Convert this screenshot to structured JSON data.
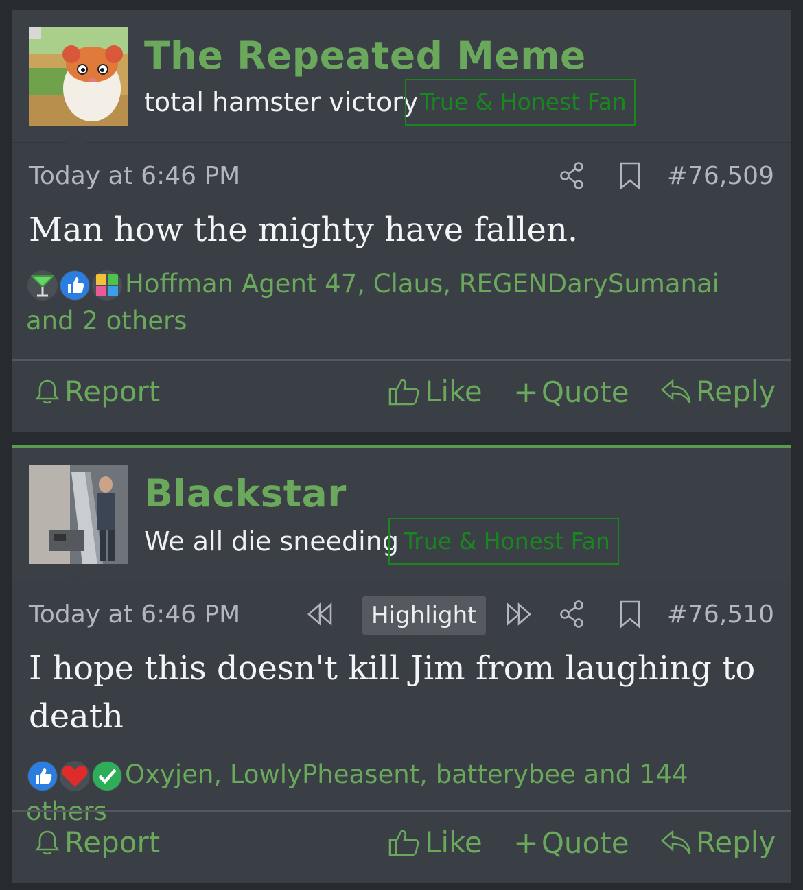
{
  "posts": [
    {
      "username": "The Repeated Meme",
      "user_title": "total hamster victory",
      "badge": "True & Honest Fan",
      "timestamp": "Today at 6:46 PM",
      "post_number": "#76,509",
      "message_lines": [
        "Man how the mighty have fallen."
      ],
      "reactions_text": "Hoffman Agent 47, Claus, REGENDarySumanai and 2 others",
      "reaction_icons": [
        "cocktail-icon",
        "thumbs-up-icon",
        "puzzle-icon"
      ],
      "actions": {
        "report": "Report",
        "like": "Like",
        "quote": "Quote",
        "reply": "Reply"
      }
    },
    {
      "username": "Blackstar",
      "user_title": "We all die sneeding",
      "badge": "True & Honest Fan",
      "timestamp": "Today at 6:46 PM",
      "highlight": "Highlight",
      "post_number": "#76,510",
      "message_lines": [
        "I hope this doesn't kill Jim from laughing to",
        "death"
      ],
      "reactions_text": "Oxyjen, LowlyPheasent, batterybee and 144 others",
      "reaction_icons": [
        "thumbs-up-icon",
        "heart-icon",
        "checkmark-icon"
      ],
      "actions": {
        "report": "Report",
        "like": "Like",
        "quote": "Quote",
        "reply": "Reply"
      }
    }
  ],
  "colors": {
    "accent_green": "#6aa85c",
    "badge_green": "#19861f",
    "post_bg": "#3b3f46",
    "page_bg": "#272a2f"
  }
}
